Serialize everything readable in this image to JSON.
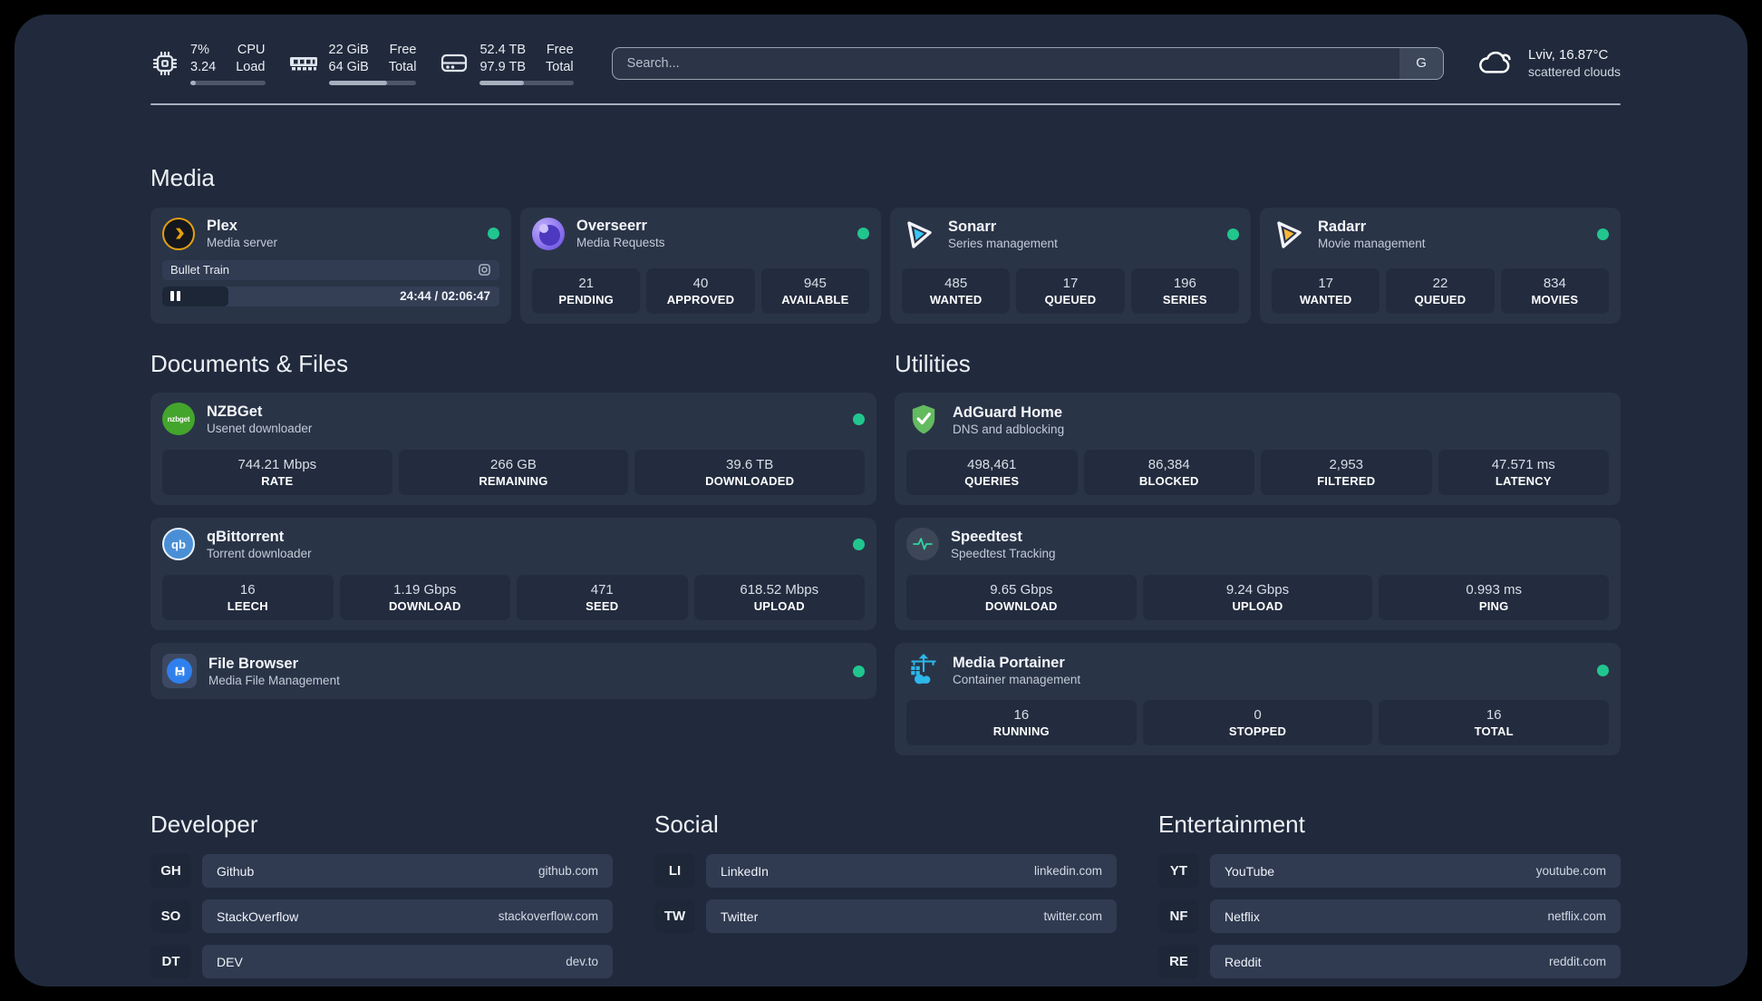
{
  "topbar": {
    "cpu": {
      "value1": "7%",
      "value2": "3.24",
      "label1": "CPU",
      "label2": "Load",
      "progress_pct": 7
    },
    "memory": {
      "value1": "22 GiB",
      "value2": "64 GiB",
      "label1": "Free",
      "label2": "Total",
      "progress_pct": 66
    },
    "disk": {
      "value1": "52.4 TB",
      "value2": "97.9 TB",
      "label1": "Free",
      "label2": "Total",
      "progress_pct": 47
    },
    "search": {
      "placeholder": "Search...",
      "engine_button": "G"
    },
    "weather": {
      "location": "Lviv, 16.87°C",
      "condition": "scattered clouds"
    }
  },
  "media": {
    "title": "Media",
    "plex": {
      "name": "Plex",
      "subtitle": "Media server",
      "now_playing": "Bullet Train",
      "time_display": "24:44 / 02:06:47",
      "progress_pct": 19.5
    },
    "overseerr": {
      "name": "Overseerr",
      "subtitle": "Media Requests",
      "stats": [
        {
          "value": "21",
          "label": "PENDING"
        },
        {
          "value": "40",
          "label": "APPROVED"
        },
        {
          "value": "945",
          "label": "AVAILABLE"
        }
      ]
    },
    "sonarr": {
      "name": "Sonarr",
      "subtitle": "Series management",
      "stats": [
        {
          "value": "485",
          "label": "WANTED"
        },
        {
          "value": "17",
          "label": "QUEUED"
        },
        {
          "value": "196",
          "label": "SERIES"
        }
      ]
    },
    "radarr": {
      "name": "Radarr",
      "subtitle": "Movie management",
      "stats": [
        {
          "value": "17",
          "label": "WANTED"
        },
        {
          "value": "22",
          "label": "QUEUED"
        },
        {
          "value": "834",
          "label": "MOVIES"
        }
      ]
    }
  },
  "documents": {
    "title": "Documents & Files",
    "nzbget": {
      "name": "NZBGet",
      "subtitle": "Usenet downloader",
      "icon_text": "nzbget",
      "stats": [
        {
          "value": "744.21 Mbps",
          "label": "RATE"
        },
        {
          "value": "266 GB",
          "label": "REMAINING"
        },
        {
          "value": "39.6 TB",
          "label": "DOWNLOADED"
        }
      ]
    },
    "qbittorrent": {
      "name": "qBittorrent",
      "subtitle": "Torrent downloader",
      "icon_text": "qb",
      "stats": [
        {
          "value": "16",
          "label": "LEECH"
        },
        {
          "value": "1.19 Gbps",
          "label": "DOWNLOAD"
        },
        {
          "value": "471",
          "label": "SEED"
        },
        {
          "value": "618.52 Mbps",
          "label": "UPLOAD"
        }
      ]
    },
    "filebrowser": {
      "name": "File Browser",
      "subtitle": "Media File Management"
    }
  },
  "utilities": {
    "title": "Utilities",
    "adguard": {
      "name": "AdGuard Home",
      "subtitle": "DNS and adblocking",
      "stats": [
        {
          "value": "498,461",
          "label": "QUERIES"
        },
        {
          "value": "86,384",
          "label": "BLOCKED"
        },
        {
          "value": "2,953",
          "label": "FILTERED"
        },
        {
          "value": "47.571 ms",
          "label": "LATENCY"
        }
      ]
    },
    "speedtest": {
      "name": "Speedtest",
      "subtitle": "Speedtest Tracking",
      "stats": [
        {
          "value": "9.65 Gbps",
          "label": "DOWNLOAD"
        },
        {
          "value": "9.24 Gbps",
          "label": "UPLOAD"
        },
        {
          "value": "0.993 ms",
          "label": "PING"
        }
      ]
    },
    "portainer": {
      "name": "Media Portainer",
      "subtitle": "Container management",
      "stats": [
        {
          "value": "16",
          "label": "RUNNING"
        },
        {
          "value": "0",
          "label": "STOPPED"
        },
        {
          "value": "16",
          "label": "TOTAL"
        }
      ]
    }
  },
  "links": {
    "developer": {
      "title": "Developer",
      "items": [
        {
          "abbr": "GH",
          "name": "Github",
          "url": "github.com"
        },
        {
          "abbr": "SO",
          "name": "StackOverflow",
          "url": "stackoverflow.com"
        },
        {
          "abbr": "DT",
          "name": "DEV",
          "url": "dev.to"
        }
      ]
    },
    "social": {
      "title": "Social",
      "items": [
        {
          "abbr": "LI",
          "name": "LinkedIn",
          "url": "linkedin.com"
        },
        {
          "abbr": "TW",
          "name": "Twitter",
          "url": "twitter.com"
        }
      ]
    },
    "entertainment": {
      "title": "Entertainment",
      "items": [
        {
          "abbr": "YT",
          "name": "YouTube",
          "url": "youtube.com"
        },
        {
          "abbr": "NF",
          "name": "Netflix",
          "url": "netflix.com"
        },
        {
          "abbr": "RE",
          "name": "Reddit",
          "url": "reddit.com"
        }
      ]
    }
  },
  "colors": {
    "panel_bg": "#212a3c",
    "card_bg": "#2a3447",
    "tile_bg": "#232c3e",
    "status_online": "#21c68f",
    "plex_amber": "#e5a00d",
    "overseerr_purple": "#8f76ef",
    "sonarr_blue": "#39c6f4",
    "radarr_amber": "#f8b63a",
    "nzbget_green": "#43a52c",
    "qbittorrent_blue": "#4a8fd6",
    "filebrowser_blue": "#2f80ed",
    "adguard_green": "#63ba5f",
    "speedtest_green": "#2fd7a2",
    "portainer_blue": "#2cb8ea"
  }
}
